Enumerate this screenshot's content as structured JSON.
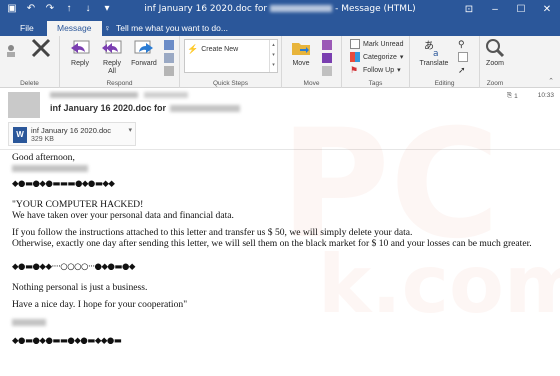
{
  "window": {
    "title_prefix": "inf January 16 2020.doc for",
    "title_suffix": "- Message (HTML)"
  },
  "tabs": {
    "file": "File",
    "message": "Message",
    "tellme": "Tell me what you want to do..."
  },
  "ribbon": {
    "delete_group": "Delete",
    "respond_group": "Respond",
    "reply": "Reply",
    "reply_all_1": "Reply",
    "reply_all_2": "All",
    "forward": "Forward",
    "quicksteps_group": "Quick Steps",
    "create_new": "Create New",
    "move_group": "Move",
    "move": "Move",
    "tags_group": "Tags",
    "mark_unread": "Mark Unread",
    "categorize": "Categorize",
    "follow_up": "Follow Up",
    "editing_group": "Editing",
    "translate": "Translate",
    "zoom_group": "Zoom",
    "zoom": "Zoom"
  },
  "header": {
    "subject": "inf January 16 2020.doc for",
    "count": "1",
    "time": "10:33"
  },
  "attachment": {
    "name": "inf January 16 2020.doc",
    "size": "329 KB"
  },
  "body": {
    "greeting": "Good afternoon,",
    "divider1": "◆●▬●◆●▬▬▬●◆●▬◆◆",
    "line1": "\"YOUR COMPUTER HACKED!",
    "line2": "We have taken over your personal data and financial data.",
    "line3": "If you follow the instructions attached to this letter and transfer us $ 50, we will simply delete your data.",
    "line4": "Otherwise, exactly one day after sending this letter, we will sell them on the black market for $ 10 and your losses can be much greater.",
    "divider2": "◆●▬●◆◆····○○○○···●◆●▬●◆",
    "line5": "Nothing personal is just a business.",
    "line6": "Have a nice day. I hope for your cooperation\"",
    "divider3": "◆●▬●◆●▬▬●◆●▬◆◆●▬"
  },
  "colors": {
    "accent": "#2b579a",
    "ribbon_bg": "#f3f3f3"
  }
}
